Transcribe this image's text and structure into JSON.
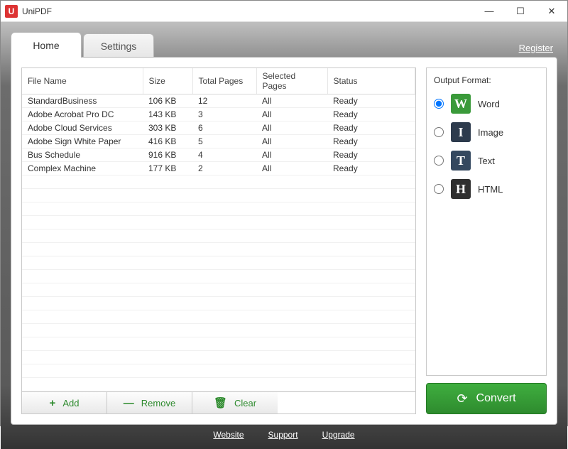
{
  "app": {
    "title": "UniPDF",
    "icon_letter": "U"
  },
  "window_controls": {
    "min": "—",
    "max": "☐",
    "close": "✕"
  },
  "tabs": {
    "home": "Home",
    "settings": "Settings"
  },
  "register": "Register",
  "table": {
    "headers": {
      "file": "File Name",
      "size": "Size",
      "pages": "Total Pages",
      "selected": "Selected Pages",
      "status": "Status"
    },
    "rows": [
      {
        "file": "StandardBusiness",
        "size": "106 KB",
        "pages": "12",
        "selected": "All",
        "status": "Ready"
      },
      {
        "file": "Adobe Acrobat Pro DC",
        "size": "143 KB",
        "pages": "3",
        "selected": "All",
        "status": "Ready"
      },
      {
        "file": "Adobe Cloud Services",
        "size": "303 KB",
        "pages": "6",
        "selected": "All",
        "status": "Ready"
      },
      {
        "file": "Adobe Sign White Paper",
        "size": "416 KB",
        "pages": "5",
        "selected": "All",
        "status": "Ready"
      },
      {
        "file": "Bus Schedule",
        "size": "916 KB",
        "pages": "4",
        "selected": "All",
        "status": "Ready"
      },
      {
        "file": "Complex Machine",
        "size": "177 KB",
        "pages": "2",
        "selected": "All",
        "status": "Ready"
      }
    ]
  },
  "buttons": {
    "add": "Add",
    "remove": "Remove",
    "clear": "Clear"
  },
  "output": {
    "title": "Output Format:",
    "options": {
      "word": {
        "label": "Word",
        "glyph": "W",
        "checked": true
      },
      "image": {
        "label": "Image",
        "glyph": "I",
        "checked": false
      },
      "text": {
        "label": "Text",
        "glyph": "T",
        "checked": false
      },
      "html": {
        "label": "HTML",
        "glyph": "H",
        "checked": false
      }
    }
  },
  "convert": "Convert",
  "footer": {
    "website": "Website",
    "support": "Support",
    "upgrade": "Upgrade"
  }
}
